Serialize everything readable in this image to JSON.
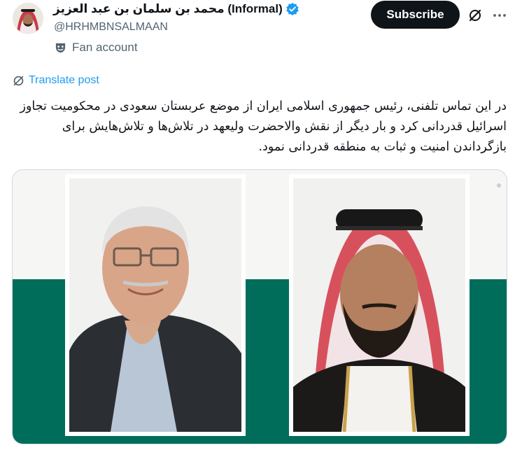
{
  "author": {
    "name": "محمد بن سلمان بن عبد العزيز (Informal)",
    "handle": "@HRHMBNSALMAAN",
    "fan_label": "Fan account",
    "verified": true
  },
  "actions": {
    "subscribe_label": "Subscribe",
    "grok_icon": "grok-icon",
    "more_icon": "more-icon"
  },
  "translate": {
    "label": "Translate post"
  },
  "post": {
    "text": "در این تماس تلفنی، رئیس جمهوری اسلامی ایران از موضع عربستان سعودی در محکومیت تجاوز اسرائیل قدردانی کرد و بار دیگر از نقش والاحضرت ولیعهد در تلاش‌ها و تلاش‌هایش برای بازگرداندن امنیت و ثبات به منطقه قدردانی نمود."
  },
  "colors": {
    "accent": "#1d9bf0",
    "media_band": "#006d5b",
    "text": "#0f1419",
    "secondary": "#536471"
  }
}
